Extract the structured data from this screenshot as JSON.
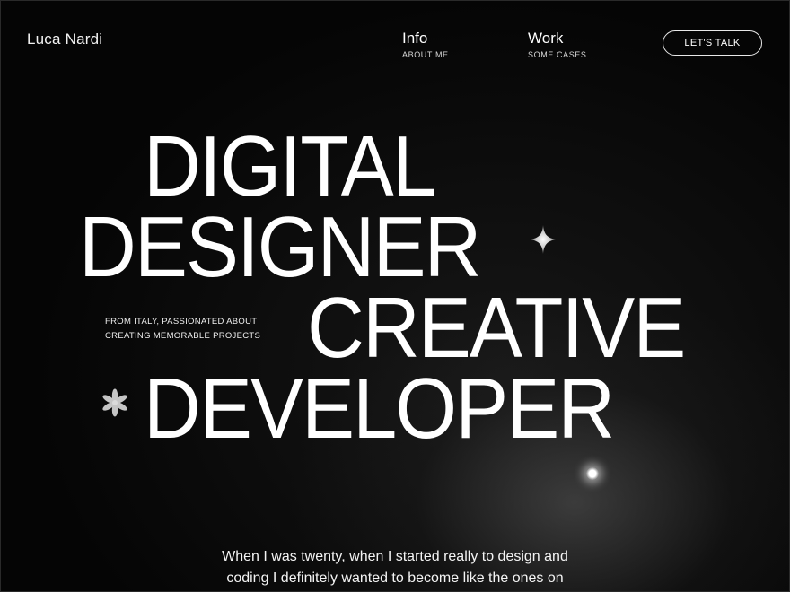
{
  "header": {
    "brand": "Luca Nardi",
    "nav": [
      {
        "label": "Info",
        "sub": "ABOUT ME"
      },
      {
        "label": "Work",
        "sub": "SOME CASES"
      }
    ],
    "cta_label": "LET'S TALK"
  },
  "hero": {
    "lines": [
      "DIGITAL",
      "DESIGNER",
      "CREATIVE",
      "DEVELOPER"
    ],
    "tagline_lines": [
      "FROM ITALY, PASSIONATED ABOUT",
      "CREATING MEMORABLE PROJECTS"
    ]
  },
  "intro": {
    "lines": [
      "When I was twenty, when I started really to design and",
      "coding I definitely wanted to become like the ones on"
    ]
  },
  "icons": {
    "sparkle": "four-point-star-icon",
    "flower": "flower-icon",
    "light": "glow-dot-icon"
  },
  "colors": {
    "background": "#050505",
    "text": "#ffffff"
  }
}
